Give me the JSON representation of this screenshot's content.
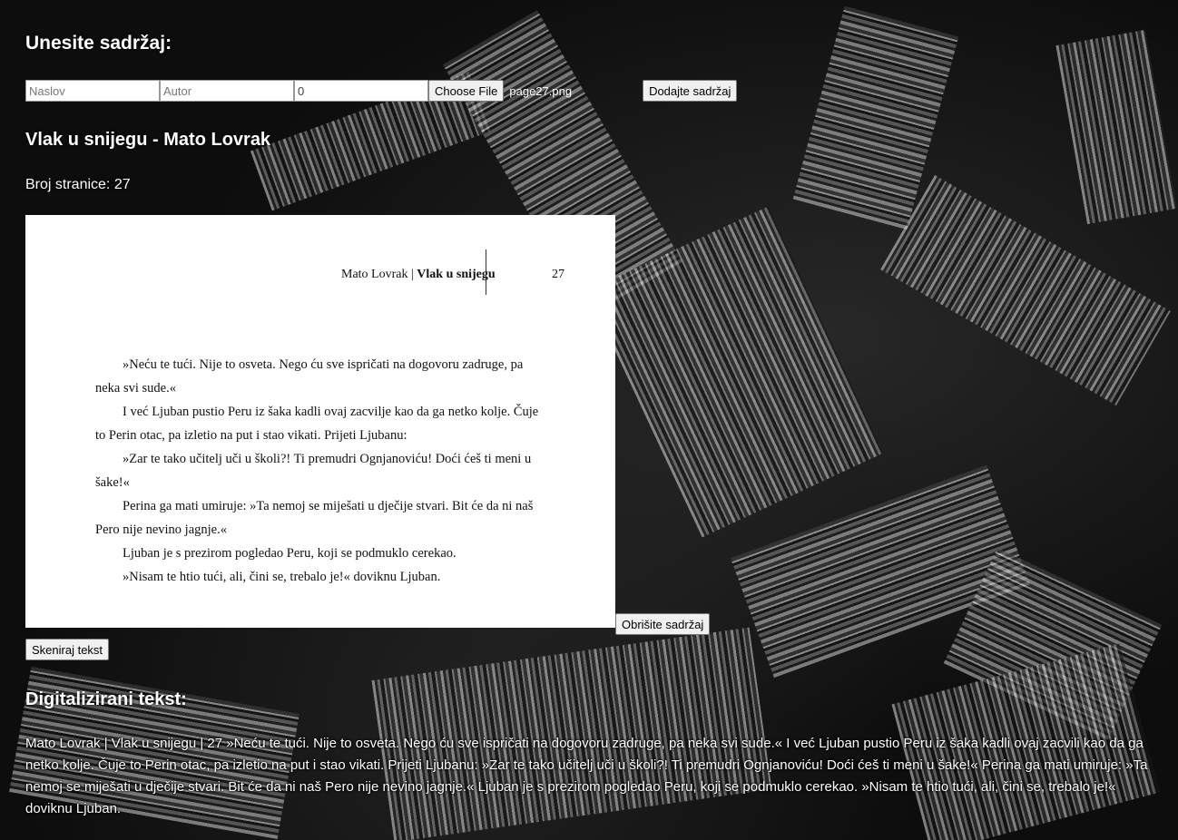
{
  "form": {
    "heading": "Unesite sadržaj:",
    "title_placeholder": "Naslov",
    "author_placeholder": "Autor",
    "page_value": "0",
    "choose_file_label": "Choose File",
    "file_name": "page27.png",
    "add_label": "Dodajte sadržaj"
  },
  "entry": {
    "title": "Vlak u snijegu - Mato Lovrak",
    "page_count": "Broj stranice: 27",
    "delete_label": "Obrišite sadržaj",
    "scan_label": "Skeniraj tekst"
  },
  "scan": {
    "author": "Mato Lovrak |",
    "book": "Vlak u snijegu",
    "page_number": "27",
    "paragraphs": [
      "»Neću te tući. Nije to osveta. Nego ću sve ispričati na dogovoru zadruge, pa neka svi sude.«",
      "I već Ljuban pustio Peru iz šaka kadli ovaj zacvilje kao da ga netko kolje. Čuje to Perin otac, pa izletio na put i stao vikati. Prijeti Ljubanu:",
      "»Zar te tako učitelj uči u školi?! Ti premudri Ognjanoviću! Doći ćeš ti meni u šake!«",
      "Perina ga mati umiruje: »Ta nemoj se miješati u dječije stvari. Bit će da ni naš Pero nije nevino jagnje.«",
      "Ljuban je s prezirom pogledao Peru, koji se podmuklo cerekao.",
      "»Nisam te htio tući, ali, čini se, trebalo je!« doviknu Ljuban."
    ]
  },
  "digital": {
    "heading": "Digitalizirani tekst:",
    "text": "Mato Lovrak | Vlak u snijegu | 27 »Neću te tući. Nije to osveta. Nego ću sve ispričati na dogovoru zadruge, pa neka svi sude.« I već Ljuban pustio Peru iz šaka kadli ovaj zacvili kao da ga netko kolje. Čuje to Perin otac, pa izletio na put i stao vikati. Prijeti Ljubanu: »Zar te tako učitelj uči u školi?! Ti premudri Ognjanoviću! Doći ćeš ti meni u šake!« Perina ga mati umiruje: »Ta nemoj se miješati u dječije stvari. Bit će da ni naš Pero nije nevino jagnje.« Ljuban je s prezirom pogledao Peru, koji se podmuklo cerekao. »Nisam te htio tući, ali, čini se, trebalo je!« doviknu Ljuban."
  }
}
